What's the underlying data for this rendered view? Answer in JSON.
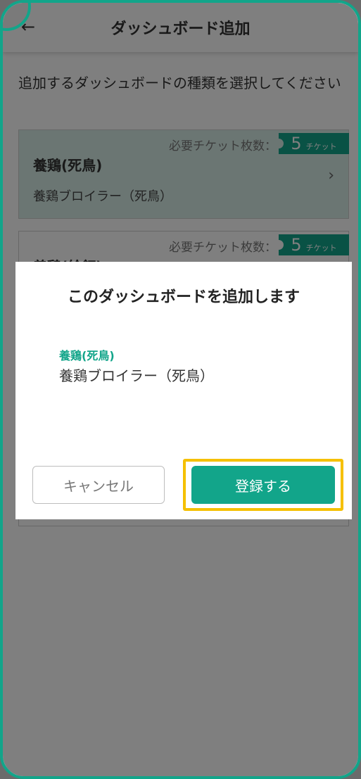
{
  "header": {
    "title": "ダッシュボード追加",
    "back_icon": "←"
  },
  "instruction": "追加するダッシュボードの種類を選択してください",
  "cards": [
    {
      "ticket_label": "必要チケット枚数：",
      "ticket_count": "5",
      "ticket_unit": "チケット",
      "title": "養鶏(死鳥)",
      "subtitle": "養鶏ブロイラー（死鳥）",
      "chevron": "›"
    },
    {
      "ticket_label": "必要チケット枚数：",
      "ticket_count": "5",
      "ticket_unit": "チケット",
      "title": "養鶏(給餌)"
    }
  ],
  "dialog": {
    "title": "このダッシュボードを追加します",
    "item_title": "養鶏(死鳥)",
    "item_subtitle": "養鶏ブロイラー（死鳥）",
    "cancel_label": "キャンセル",
    "register_label": "登録する"
  },
  "colors": {
    "accent": "#12a58a",
    "highlight": "#f5c000",
    "selected_card": "#d7ece7"
  }
}
